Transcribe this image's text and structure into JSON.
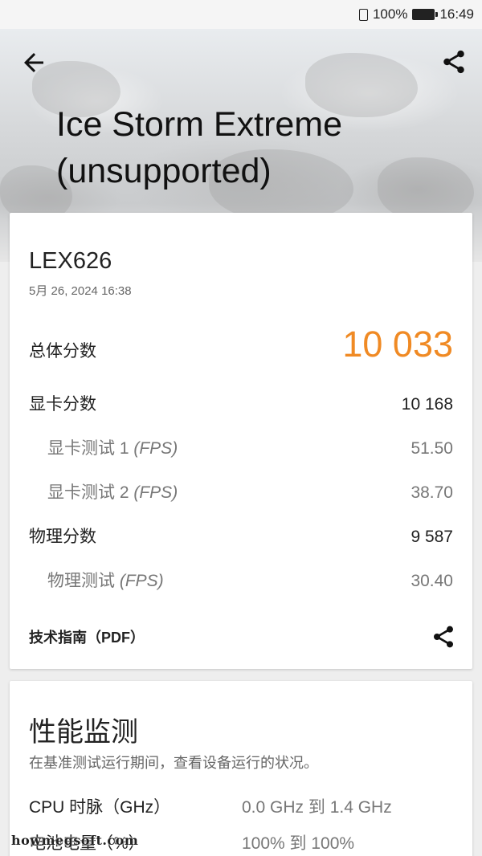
{
  "status_bar": {
    "battery_text": "100%",
    "time": "16:49"
  },
  "header": {
    "title_line1": "Ice Storm Extreme",
    "title_line2": "(unsupported)"
  },
  "result": {
    "device": "LEX626",
    "date": "5月 26, 2024 16:38",
    "overall": {
      "label": "总体分数",
      "value": "10 033"
    },
    "graphics": {
      "label": "显卡分数",
      "value": "10 168"
    },
    "graphics_test1": {
      "label": "显卡测试 1",
      "unit": "(FPS)",
      "value": "51.50"
    },
    "graphics_test2": {
      "label": "显卡测试 2",
      "unit": "(FPS)",
      "value": "38.70"
    },
    "physics": {
      "label": "物理分数",
      "value": "9 587"
    },
    "physics_test": {
      "label": "物理测试",
      "unit": "(FPS)",
      "value": "30.40"
    },
    "tech_guide": "技术指南（PDF）"
  },
  "performance": {
    "title": "性能监测",
    "description": "在基准测试运行期间，查看设备运行的状况。",
    "rows": [
      {
        "label": "CPU 时脉（GHz）",
        "value": "0.0 GHz 到 1.4 GHz"
      },
      {
        "label": "电池电量（%）",
        "value": "100% 到 100%"
      }
    ]
  },
  "watermark": "howmegsoft.com",
  "colors": {
    "accent_orange": "#f08a24",
    "background": "#eeeeee",
    "card": "#ffffff"
  },
  "icons": {
    "back": "arrow-left-icon",
    "share": "share-icon",
    "sim": "sim-card-icon",
    "battery": "battery-icon"
  }
}
